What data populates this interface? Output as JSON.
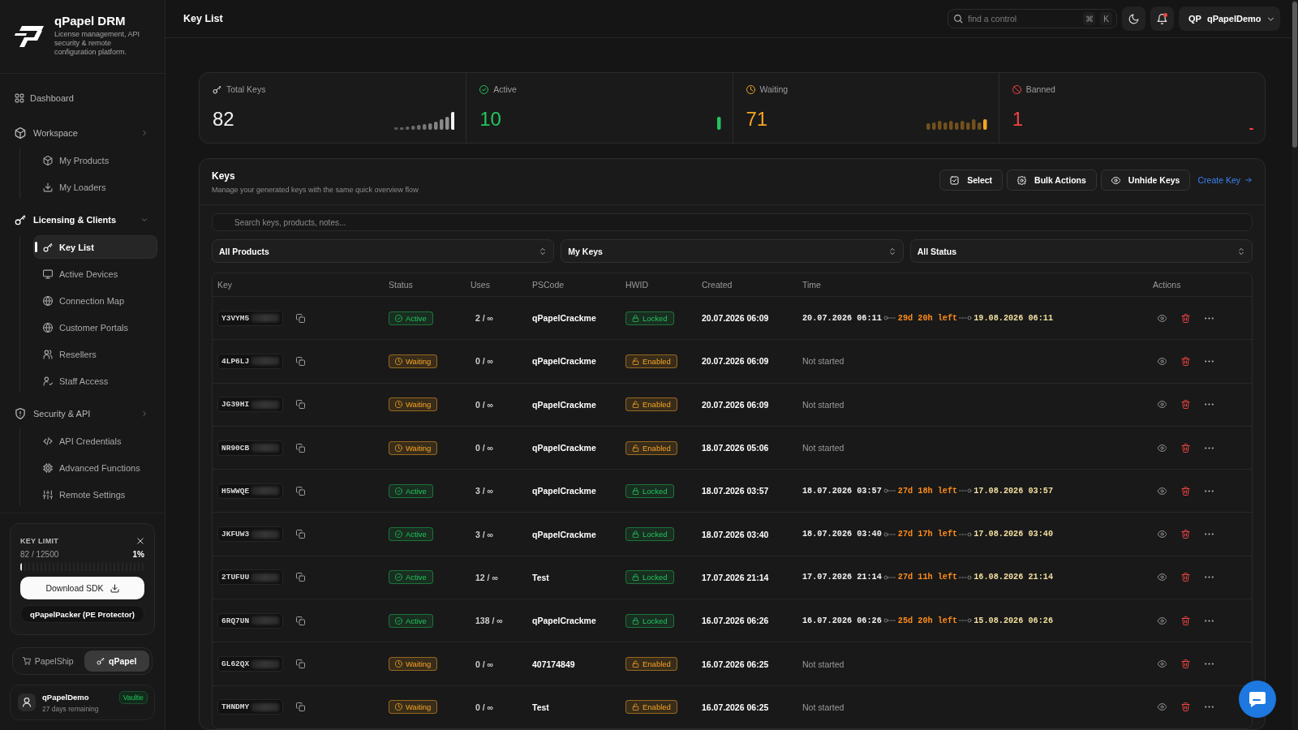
{
  "brand": {
    "name": "qPapel DRM",
    "tagline": "License management, API security & remote configuration platform."
  },
  "sidebar": {
    "items": [
      {
        "kind": "link",
        "label": "Dashboard",
        "selected": false
      },
      {
        "kind": "group",
        "label": "Workspace",
        "expanded": false,
        "children": [
          {
            "label": "My Products",
            "selected": false
          },
          {
            "label": "My Loaders",
            "selected": false
          }
        ]
      },
      {
        "kind": "group",
        "label": "Licensing & Clients",
        "expanded": true,
        "children": [
          {
            "label": "Key List",
            "selected": true
          },
          {
            "label": "Active Devices",
            "selected": false
          },
          {
            "label": "Connection Map",
            "selected": false
          },
          {
            "label": "Customer Portals",
            "selected": false
          },
          {
            "label": "Resellers",
            "selected": false
          },
          {
            "label": "Staff Access",
            "selected": false
          }
        ]
      },
      {
        "kind": "group",
        "label": "Security & API",
        "expanded": false,
        "children": [
          {
            "label": "API Credentials",
            "selected": false
          },
          {
            "label": "Advanced Functions",
            "selected": false
          },
          {
            "label": "Remote Settings",
            "selected": false
          }
        ]
      }
    ]
  },
  "key_limit": {
    "title": "KEY LIMIT",
    "count": "82 / 12500",
    "percent": "1%",
    "level": 0.01,
    "download_button": "Download SDK",
    "secondary_button": "qPapelPacker (PE Protector)"
  },
  "app_switch": [
    {
      "label": "PapelShip",
      "selected": false
    },
    {
      "label": "qPapel",
      "selected": true
    }
  ],
  "account": {
    "name": "qPapelDemo",
    "plan": "Vaultie",
    "note": "27 days remaining"
  },
  "header": {
    "title": "Key List",
    "search": {
      "placeholder": "find a control",
      "shortcut": [
        "⌘",
        "K"
      ]
    },
    "notifications": {
      "unread": true
    },
    "user": {
      "initials": "QP",
      "name": "qPapelDemo"
    }
  },
  "stats": [
    {
      "kind": "total",
      "label": "Total Keys",
      "value": "82",
      "color": "#f2f2f2"
    },
    {
      "kind": "active",
      "label": "Active",
      "value": "10",
      "color": "#22c55e"
    },
    {
      "kind": "waiting",
      "label": "Waiting",
      "value": "71",
      "color": "#f5a524"
    },
    {
      "kind": "banned",
      "label": "Banned",
      "value": "1",
      "color": "#ef4444"
    }
  ],
  "keys": {
    "title": "Keys",
    "subtitle": "Manage your generated keys with the same quick overview flow",
    "actions": [
      {
        "kind": "select",
        "label": "Select"
      },
      {
        "kind": "bulk",
        "label": "Bulk Actions"
      },
      {
        "kind": "unhide",
        "label": "Unhide Keys"
      },
      {
        "kind": "create",
        "label": "Create Key"
      }
    ],
    "search": {
      "placeholder": "Search keys, products, notes..."
    },
    "filters": [
      "All Products",
      "My Keys",
      "All Status"
    ],
    "table": {
      "columns": [
        "Key",
        "Status",
        "Uses",
        "PSCode",
        "HWID",
        "Created",
        "Time",
        "Actions"
      ],
      "rows": [
        {
          "key": "Y3VYM5",
          "status": {
            "kind": "active",
            "label": "Active"
          },
          "uses": "2 / ∞",
          "pscode": "qPapelCrackme",
          "hwid": {
            "kind": "locked",
            "label": "Locked"
          },
          "created": "20.07.2026 06:09",
          "time": {
            "kind": "countdown",
            "start": "20.07.2026 06:11",
            "remaining": "29d 20h left",
            "end": "19.08.2026 06:11"
          }
        },
        {
          "key": "4LP6LJ",
          "status": {
            "kind": "waiting",
            "label": "Waiting"
          },
          "uses": "0 / ∞",
          "pscode": "qPapelCrackme",
          "hwid": {
            "kind": "enabled",
            "label": "Enabled"
          },
          "created": "20.07.2026 06:09",
          "time": {
            "kind": "text",
            "text": "Not started"
          }
        },
        {
          "key": "JG39HI",
          "status": {
            "kind": "waiting",
            "label": "Waiting"
          },
          "uses": "0 / ∞",
          "pscode": "qPapelCrackme",
          "hwid": {
            "kind": "enabled",
            "label": "Enabled"
          },
          "created": "20.07.2026 06:09",
          "time": {
            "kind": "text",
            "text": "Not started"
          }
        },
        {
          "key": "NR90CB",
          "status": {
            "kind": "waiting",
            "label": "Waiting"
          },
          "uses": "0 / ∞",
          "pscode": "qPapelCrackme",
          "hwid": {
            "kind": "enabled",
            "label": "Enabled"
          },
          "created": "18.07.2026 05:06",
          "time": {
            "kind": "text",
            "text": "Not started"
          }
        },
        {
          "key": "H5WWQE",
          "status": {
            "kind": "active",
            "label": "Active"
          },
          "uses": "3 / ∞",
          "pscode": "qPapelCrackme",
          "hwid": {
            "kind": "locked",
            "label": "Locked"
          },
          "created": "18.07.2026 03:57",
          "time": {
            "kind": "countdown",
            "start": "18.07.2026 03:57",
            "remaining": "27d 18h left",
            "end": "17.08.2026 03:57"
          }
        },
        {
          "key": "JKFUW3",
          "status": {
            "kind": "active",
            "label": "Active"
          },
          "uses": "3 / ∞",
          "pscode": "qPapelCrackme",
          "hwid": {
            "kind": "locked",
            "label": "Locked"
          },
          "created": "18.07.2026 03:40",
          "time": {
            "kind": "countdown",
            "start": "18.07.2026 03:40",
            "remaining": "27d 17h left",
            "end": "17.08.2026 03:40"
          }
        },
        {
          "key": "2TUFUU",
          "status": {
            "kind": "active",
            "label": "Active"
          },
          "uses": "12 / ∞",
          "pscode": "Test",
          "hwid": {
            "kind": "locked",
            "label": "Locked"
          },
          "created": "17.07.2026 21:14",
          "time": {
            "kind": "countdown",
            "start": "17.07.2026 21:14",
            "remaining": "27d 11h left",
            "end": "16.08.2026 21:14"
          }
        },
        {
          "key": "6RQ7UN",
          "status": {
            "kind": "active",
            "label": "Active"
          },
          "uses": "138 / ∞",
          "pscode": "qPapelCrackme",
          "hwid": {
            "kind": "locked",
            "label": "Locked"
          },
          "created": "16.07.2026 06:26",
          "time": {
            "kind": "countdown",
            "start": "16.07.2026 06:26",
            "remaining": "25d 20h left",
            "end": "15.08.2026 06:26"
          }
        },
        {
          "key": "GL62QX",
          "status": {
            "kind": "waiting",
            "label": "Waiting"
          },
          "uses": "0 / ∞",
          "pscode": "407174849",
          "hwid": {
            "kind": "enabled",
            "label": "Enabled"
          },
          "created": "16.07.2026 06:25",
          "time": {
            "kind": "text",
            "text": "Not started"
          }
        },
        {
          "key": "THNDMY",
          "status": {
            "kind": "waiting",
            "label": "Waiting"
          },
          "uses": "0 / ∞",
          "pscode": "Test",
          "hwid": {
            "kind": "enabled",
            "label": "Enabled"
          },
          "created": "16.07.2026 06:25",
          "time": {
            "kind": "text",
            "text": "Not started"
          }
        }
      ]
    }
  }
}
